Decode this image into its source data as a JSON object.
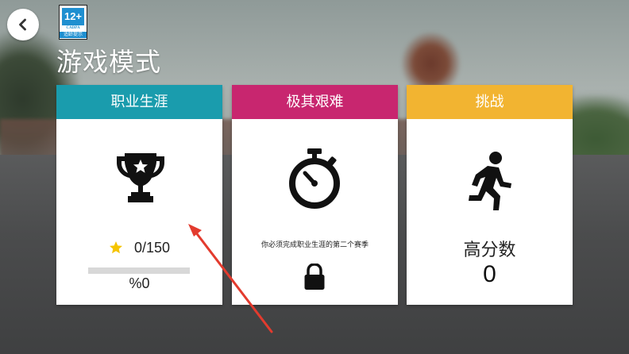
{
  "age_badge": {
    "rating": "12+",
    "org": "CADPA",
    "tip": "适龄提示"
  },
  "page_title": "游戏模式",
  "colors": {
    "career": "#1a9cad",
    "hard": "#c8266f",
    "challenge": "#f2b431",
    "star": "#f5c400",
    "annotation_arrow": "#e33b2e"
  },
  "cards": {
    "career": {
      "title": "职业生涯",
      "icon": "trophy-icon",
      "progress_count": "0/150",
      "progress_percent_text": "%0",
      "progress_fraction": 0
    },
    "hard": {
      "title": "极其艰难",
      "icon": "stopwatch-icon",
      "lock_message": "你必须完成职业生涯的第二个赛季",
      "lock_icon": "lock-icon"
    },
    "challenge": {
      "title": "挑战",
      "icon": "running-man-icon",
      "score_label": "高分数",
      "score_value": "0"
    }
  },
  "back_icon": "chevron-left-icon"
}
